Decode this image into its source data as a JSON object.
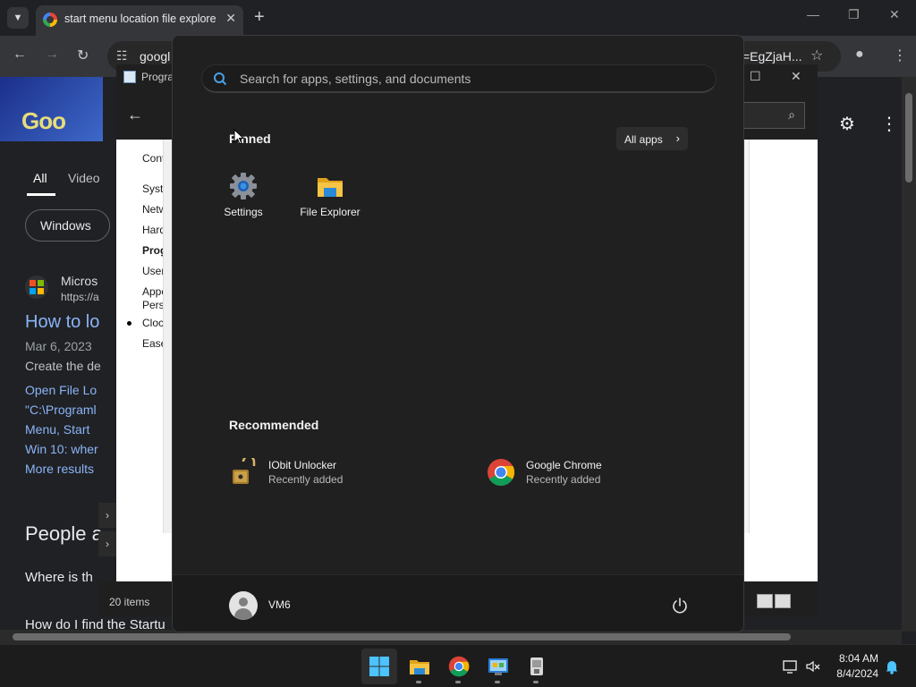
{
  "browser": {
    "tab_title": "start menu location file explorer",
    "address_prefix": "googl",
    "address_suffix": "=EgZjaH..."
  },
  "google_page": {
    "tabs": [
      "All",
      "Video"
    ],
    "chip": "Windows",
    "result_site": "Micros",
    "result_url": "https://a",
    "result_title": "How to lo",
    "result_date": "Mar 6, 2023",
    "result_snippet": "Create the de",
    "result_line1": "Open File Lo",
    "result_line2": "\"C:\\Programl",
    "result_line3": "Menu, Start",
    "result_line4": "Win 10: wher",
    "more_results": "More results",
    "people_also": "People a",
    "question1": "Where is th",
    "question2": "How do I find the Startu"
  },
  "control_panel": {
    "title": "Progra",
    "left_links": [
      "Cont",
      "Syste",
      "Netw",
      "Hard",
      "Prog",
      "User",
      "Appe",
      "Perso",
      "Clock",
      "Ease"
    ],
    "status": "20 items",
    "side_link": "s"
  },
  "start_menu": {
    "search_placeholder": "Search for apps, settings, and documents",
    "pinned_title": "Pinned",
    "all_apps_label": "All apps",
    "pinned": [
      {
        "label": "Settings",
        "icon": "settings-gear-icon"
      },
      {
        "label": "File Explorer",
        "icon": "folder-icon"
      }
    ],
    "recommended_title": "Recommended",
    "recommended": [
      {
        "name": "IObit Unlocker",
        "sub": "Recently added",
        "icon": "padlock-icon"
      },
      {
        "name": "Google Chrome",
        "sub": "Recently added",
        "icon": "chrome-icon"
      }
    ],
    "user": "VM6"
  },
  "taskbar": {
    "time": "8:04 AM",
    "date": "8/4/2024",
    "apps": [
      "start-icon",
      "file-explorer-icon",
      "chrome-icon",
      "control-panel-icon",
      "unlocker-icon"
    ]
  },
  "colors": {
    "start_bg": "#202020",
    "accent": "#0078d4",
    "folder": "#f4c430"
  }
}
